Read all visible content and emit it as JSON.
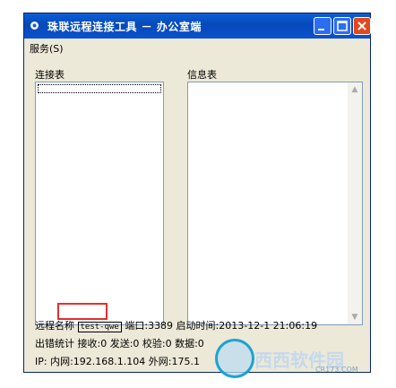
{
  "window": {
    "title": "珠联远程连接工具 － 办公室端",
    "colors": {
      "titlebar": "#0a5fd8",
      "frame": "#ece9d8",
      "close": "#e04a20"
    }
  },
  "menu": {
    "service_label": "服务(S)"
  },
  "left_panel": {
    "label": "连接表"
  },
  "right_panel": {
    "label": "信息表"
  },
  "status": {
    "remote_name_label": "远程名称",
    "remote_name_value": "test-qwe",
    "port_text": "端口:3389 启动时间:2013-12-1 21:06:19",
    "errors_text": "出错统计 接收:0 发送:0 校验:0 数据:0",
    "ip_text": "IP: 内网:192.168.1.104 外网:175.1"
  },
  "watermark": {
    "brand": "西西软件园",
    "url": "CR173.COM"
  }
}
